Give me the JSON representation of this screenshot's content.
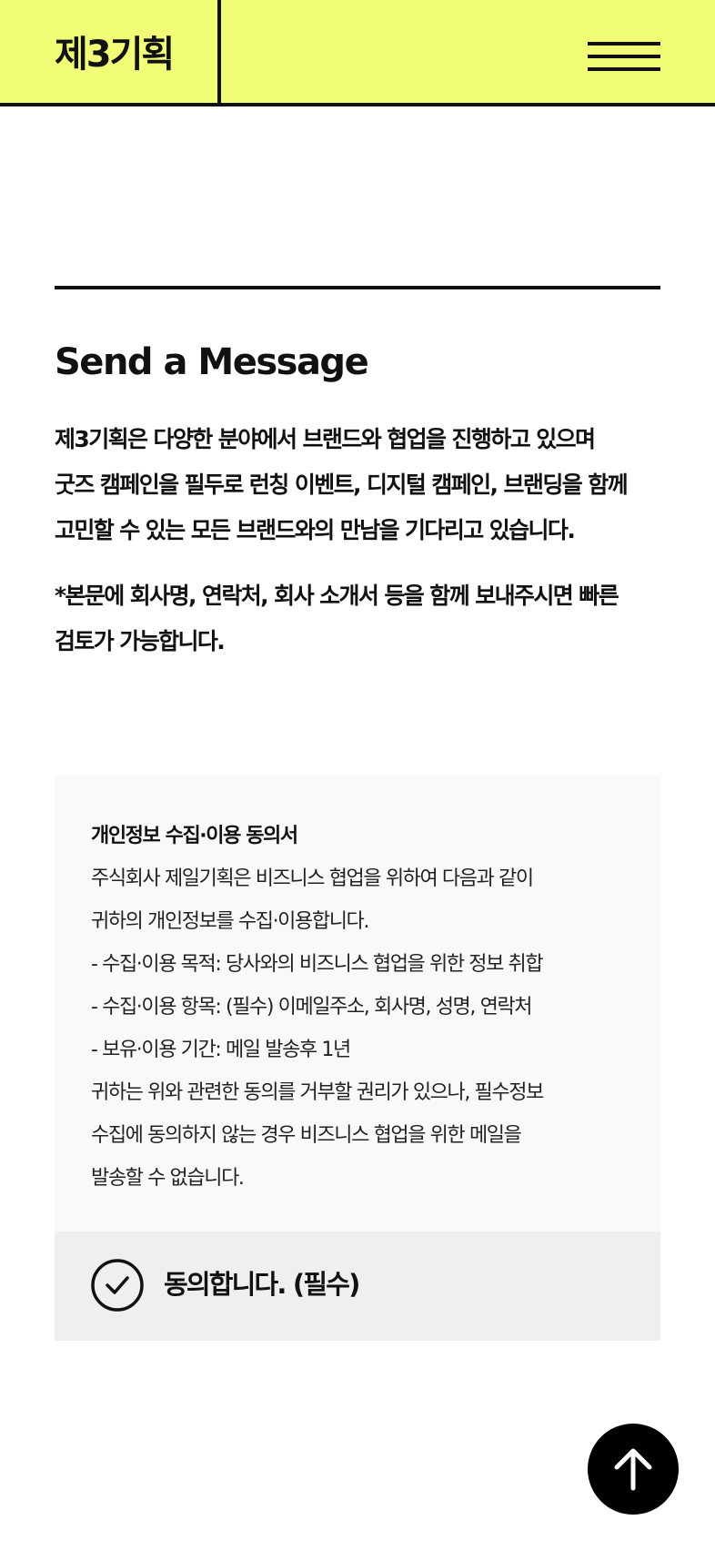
{
  "header": {
    "logo": "제3기획",
    "menu_icon": "hamburger-menu-icon"
  },
  "main": {
    "title": "Send a Message",
    "intro": [
      "제3기획은 다양한 분야에서 브랜드와 협업을 진행하고 있으며",
      "굿즈 캠페인을 필두로 런칭 이벤트, 디지털 캠페인, 브랜딩을 함께",
      "고민할 수 있는 모든 브랜드와의 만남을 기다리고 있습니다."
    ],
    "note": [
      "*본문에 회사명, 연락처, 회사 소개서 등을 함께 보내주시면 빠른",
      "검토가 가능합니다."
    ]
  },
  "consent": {
    "title": "개인정보 수집·이용 동의서",
    "lines": [
      "주식회사 제일기획은 비즈니스 협업을 위하여 다음과 같이",
      "귀하의 개인정보를 수집·이용합니다.",
      "- 수집·이용 목적: 당사와의 비즈니스 협업을 위한 정보 취합",
      "- 수집·이용 항목: (필수) 이메일주소, 회사명, 성명, 연락처",
      "- 보유·이용 기간: 메일 발송후 1년",
      "귀하는 위와 관련한 동의를 거부할 권리가 있으나, 필수정보",
      "수집에 동의하지 않는 경우 비즈니스 협업을 위한 메일을",
      "발송할 수 없습니다."
    ],
    "agree_label": "동의합니다. (필수)",
    "agree_checked": true,
    "check_icon": "check-circle-icon"
  },
  "scroll_top": {
    "icon": "arrow-up-icon"
  },
  "colors": {
    "header_bg": "#f1fd77",
    "text": "#111111",
    "consent_bg": "#f9f9f9",
    "agree_bg": "#efefef"
  }
}
